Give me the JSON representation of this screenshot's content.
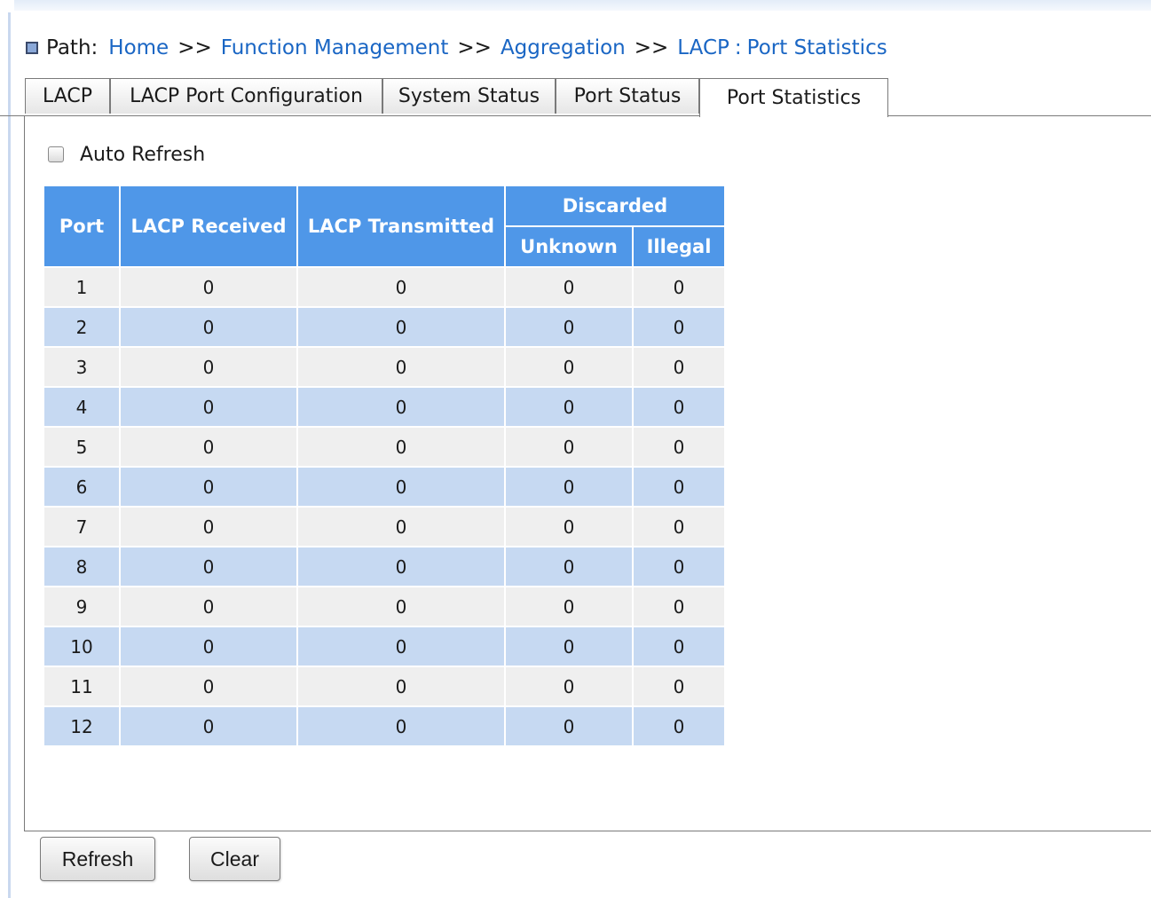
{
  "path": {
    "label": "Path:",
    "crumbs": [
      "Home",
      "Function Management",
      "Aggregation"
    ],
    "separator": ">>",
    "section": "LACP",
    "colon": ":",
    "page": "Port Statistics"
  },
  "tabs": [
    "LACP",
    "LACP Port Configuration",
    "System Status",
    "Port Status",
    "Port Statistics"
  ],
  "active_tab": "Port Statistics",
  "auto_refresh": {
    "label": "Auto Refresh",
    "checked": false
  },
  "table": {
    "headers": {
      "port": "Port",
      "lacp_received": "LACP Received",
      "lacp_transmitted": "LACP Transmitted",
      "discarded": "Discarded",
      "unknown": "Unknown",
      "illegal": "Illegal"
    },
    "rows": [
      {
        "port": "1",
        "received": "0",
        "transmitted": "0",
        "unknown": "0",
        "illegal": "0"
      },
      {
        "port": "2",
        "received": "0",
        "transmitted": "0",
        "unknown": "0",
        "illegal": "0"
      },
      {
        "port": "3",
        "received": "0",
        "transmitted": "0",
        "unknown": "0",
        "illegal": "0"
      },
      {
        "port": "4",
        "received": "0",
        "transmitted": "0",
        "unknown": "0",
        "illegal": "0"
      },
      {
        "port": "5",
        "received": "0",
        "transmitted": "0",
        "unknown": "0",
        "illegal": "0"
      },
      {
        "port": "6",
        "received": "0",
        "transmitted": "0",
        "unknown": "0",
        "illegal": "0"
      },
      {
        "port": "7",
        "received": "0",
        "transmitted": "0",
        "unknown": "0",
        "illegal": "0"
      },
      {
        "port": "8",
        "received": "0",
        "transmitted": "0",
        "unknown": "0",
        "illegal": "0"
      },
      {
        "port": "9",
        "received": "0",
        "transmitted": "0",
        "unknown": "0",
        "illegal": "0"
      },
      {
        "port": "10",
        "received": "0",
        "transmitted": "0",
        "unknown": "0",
        "illegal": "0"
      },
      {
        "port": "11",
        "received": "0",
        "transmitted": "0",
        "unknown": "0",
        "illegal": "0"
      },
      {
        "port": "12",
        "received": "0",
        "transmitted": "0",
        "unknown": "0",
        "illegal": "0"
      }
    ]
  },
  "buttons": {
    "refresh": "Refresh",
    "clear": "Clear"
  },
  "colors": {
    "header_bg": "#4f97e8",
    "row_odd": "#efefef",
    "row_even": "#c6d9f2",
    "link": "#1a66c4"
  }
}
